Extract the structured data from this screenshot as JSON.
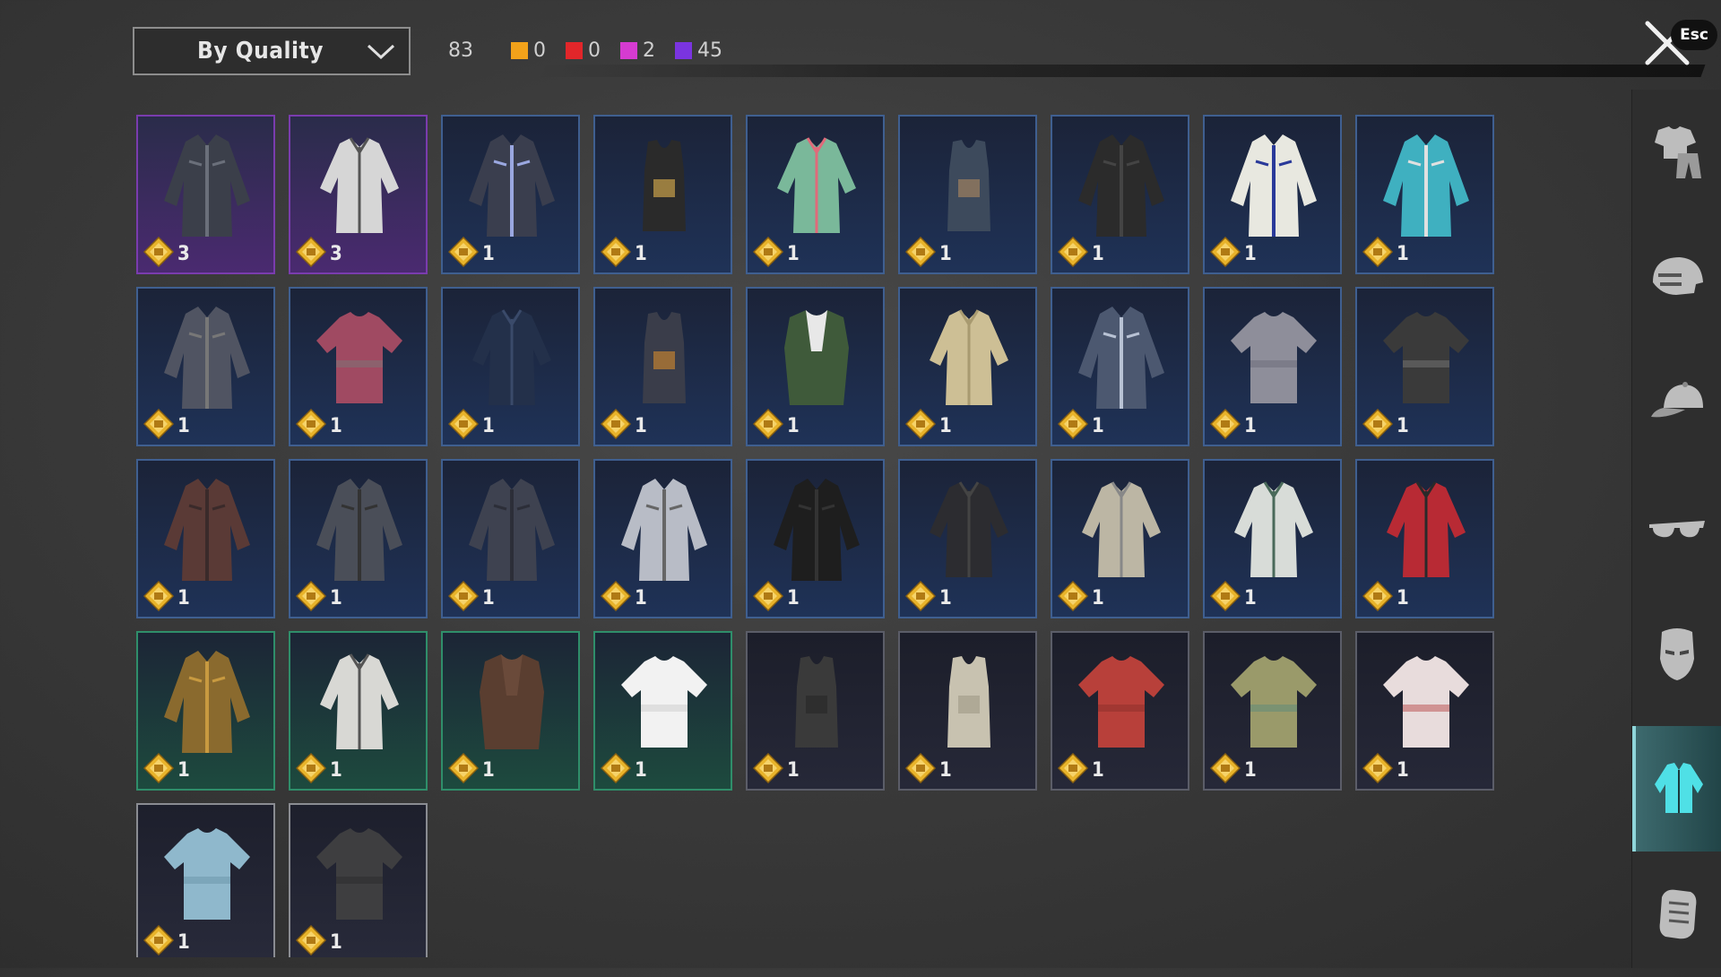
{
  "sort": {
    "label": "By Quality"
  },
  "counts": {
    "total": "83",
    "quality": [
      {
        "color": "#f2a21a",
        "value": "0"
      },
      {
        "color": "#e2262a",
        "value": "0"
      },
      {
        "color": "#d63bd1",
        "value": "2"
      },
      {
        "color": "#7a34e0",
        "value": "45"
      }
    ]
  },
  "close": {
    "esc_label": "Esc"
  },
  "sidebar": [
    {
      "icon": "outfit-icon",
      "active": false
    },
    {
      "icon": "helmet-icon",
      "active": false
    },
    {
      "icon": "cap-icon",
      "active": false
    },
    {
      "icon": "sunglasses-icon",
      "active": false
    },
    {
      "icon": "mask-icon",
      "active": false
    },
    {
      "icon": "jacket-icon",
      "active": true
    },
    {
      "icon": "gloves-icon",
      "active": false
    }
  ],
  "items": [
    {
      "qty": "3",
      "rarity": "purple",
      "garment": "jacket",
      "color": "#3b3f4a",
      "accent": "#6a6f7a"
    },
    {
      "qty": "3",
      "rarity": "purple",
      "garment": "shirt",
      "color": "#d6d6d6",
      "accent": "#555"
    },
    {
      "qty": "1",
      "rarity": "blue",
      "garment": "jacket",
      "color": "#3a3e4e",
      "accent": "#9aa7e0"
    },
    {
      "qty": "1",
      "rarity": "blue",
      "garment": "tank",
      "color": "#2a2a2a",
      "accent": "#c9a14a"
    },
    {
      "qty": "1",
      "rarity": "blue",
      "garment": "shirt",
      "color": "#7ab89a",
      "accent": "#e06a7a"
    },
    {
      "qty": "1",
      "rarity": "blue",
      "garment": "tank",
      "color": "#3d4a5c",
      "accent": "#a08060"
    },
    {
      "qty": "1",
      "rarity": "blue",
      "garment": "jacket",
      "color": "#2b2b2b",
      "accent": "#444"
    },
    {
      "qty": "1",
      "rarity": "blue",
      "garment": "jacket",
      "color": "#e8e8e0",
      "accent": "#2a3a9a"
    },
    {
      "qty": "1",
      "rarity": "blue",
      "garment": "jacket",
      "color": "#3fb0c0",
      "accent": "#e0e0e0"
    },
    {
      "qty": "1",
      "rarity": "blue",
      "garment": "jacket",
      "color": "#505462",
      "accent": "#777"
    },
    {
      "qty": "1",
      "rarity": "blue",
      "garment": "tee",
      "color": "#a04a62",
      "accent": "#777"
    },
    {
      "qty": "1",
      "rarity": "blue",
      "garment": "shirt",
      "color": "#23304a",
      "accent": "#3a4a6a"
    },
    {
      "qty": "1",
      "rarity": "blue",
      "garment": "tank",
      "color": "#3a3d4a",
      "accent": "#c08030"
    },
    {
      "qty": "1",
      "rarity": "blue",
      "garment": "vest",
      "color": "#e8e8e8",
      "accent": "#3f5a3a"
    },
    {
      "qty": "1",
      "rarity": "blue",
      "garment": "shirt",
      "color": "#cdbf95",
      "accent": "#a89a70"
    },
    {
      "qty": "1",
      "rarity": "blue",
      "garment": "jacket",
      "color": "#4c5870",
      "accent": "#b8c2d4"
    },
    {
      "qty": "1",
      "rarity": "blue",
      "garment": "tee",
      "color": "#8e8e9a",
      "accent": "#6a6a78"
    },
    {
      "qty": "1",
      "rarity": "blue",
      "garment": "tee",
      "color": "#3a3a3a",
      "accent": "#777"
    },
    {
      "qty": "1",
      "rarity": "blue",
      "garment": "jacket",
      "color": "#5a3a36",
      "accent": "#3a2a2a"
    },
    {
      "qty": "1",
      "rarity": "blue",
      "garment": "jacket",
      "color": "#4a4e58",
      "accent": "#333"
    },
    {
      "qty": "1",
      "rarity": "blue",
      "garment": "jacket",
      "color": "#3e4250",
      "accent": "#2c2e38"
    },
    {
      "qty": "1",
      "rarity": "blue",
      "garment": "jacket",
      "color": "#b8bcc6",
      "accent": "#666"
    },
    {
      "qty": "1",
      "rarity": "blue",
      "garment": "jacket",
      "color": "#1e1e1e",
      "accent": "#333"
    },
    {
      "qty": "1",
      "rarity": "blue",
      "garment": "shirt",
      "color": "#2c2c30",
      "accent": "#444"
    },
    {
      "qty": "1",
      "rarity": "blue",
      "garment": "shirt",
      "color": "#bcb6a4",
      "accent": "#888"
    },
    {
      "qty": "1",
      "rarity": "blue",
      "garment": "shirt",
      "color": "#d8dcd8",
      "accent": "#4a6a5a"
    },
    {
      "qty": "1",
      "rarity": "blue",
      "garment": "shirt",
      "color": "#b82a34",
      "accent": "#2a2a2a"
    },
    {
      "qty": "1",
      "rarity": "green",
      "garment": "jacket",
      "color": "#8a6a2e",
      "accent": "#c89a40"
    },
    {
      "qty": "1",
      "rarity": "green",
      "garment": "shirt",
      "color": "#d8d8d4",
      "accent": "#555"
    },
    {
      "qty": "1",
      "rarity": "green",
      "garment": "vest",
      "color": "#6a4a3a",
      "accent": "#5a3e30"
    },
    {
      "qty": "1",
      "rarity": "green",
      "garment": "tee",
      "color": "#f2f2f2",
      "accent": "#ccc"
    },
    {
      "qty": "1",
      "rarity": "gray",
      "garment": "tank",
      "color": "#3a3a3a",
      "accent": "#2a2a2a"
    },
    {
      "qty": "1",
      "rarity": "gray",
      "garment": "tank",
      "color": "#c8c2b0",
      "accent": "#a49e8c"
    },
    {
      "qty": "1",
      "rarity": "gray",
      "garment": "tee",
      "color": "#b8403a",
      "accent": "#8a2e2a"
    },
    {
      "qty": "1",
      "rarity": "gray",
      "garment": "tee",
      "color": "#9a9a6a",
      "accent": "#5a8a7a"
    },
    {
      "qty": "1",
      "rarity": "gray",
      "garment": "tee",
      "color": "#e8dcdc",
      "accent": "#b84a4a"
    },
    {
      "qty": "1",
      "rarity": "white",
      "garment": "tee",
      "color": "#8fb8cc",
      "accent": "#6a94a8"
    },
    {
      "qty": "1",
      "rarity": "white",
      "garment": "tee",
      "color": "#3e3e40",
      "accent": "#2a2a2c"
    }
  ]
}
